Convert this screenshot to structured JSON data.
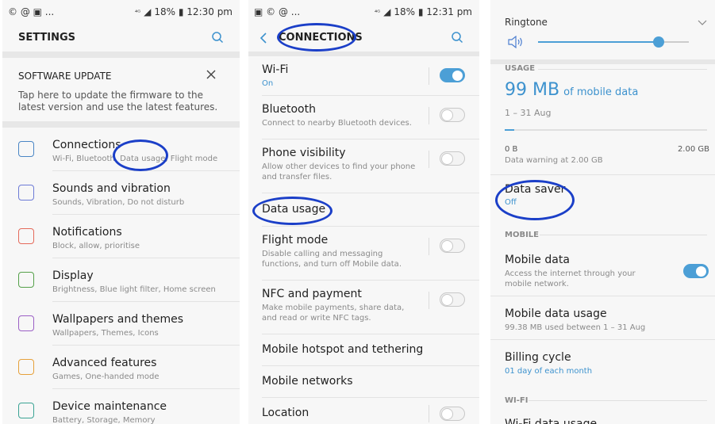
{
  "panel1": {
    "status_icons_left": "© @ ▣ ...",
    "status_right": "18% ▮ 12:30 pm",
    "title": "SETTINGS",
    "software_update": {
      "heading": "SOFTWARE UPDATE",
      "body": "Tap here to update the firmware to the latest version and use the latest features."
    },
    "items": [
      {
        "title": "Connections",
        "sub": "Wi-Fi, Bluetooth, Data usage, Flight mode",
        "icon": "connections-icon",
        "color": "#4a86c5"
      },
      {
        "title": "Sounds and vibration",
        "sub": "Sounds, Vibration, Do not disturb",
        "icon": "sound-icon",
        "color": "#6d7bd6"
      },
      {
        "title": "Notifications",
        "sub": "Block, allow, prioritise",
        "icon": "notifications-icon",
        "color": "#e56a5b"
      },
      {
        "title": "Display",
        "sub": "Brightness, Blue light filter, Home screen",
        "icon": "display-icon",
        "color": "#55a14a"
      },
      {
        "title": "Wallpapers and themes",
        "sub": "Wallpapers, Themes, Icons",
        "icon": "wallpaper-icon",
        "color": "#9b5fc5"
      },
      {
        "title": "Advanced features",
        "sub": "Games, One-handed mode",
        "icon": "advanced-features-icon",
        "color": "#e6a13b"
      },
      {
        "title": "Device maintenance",
        "sub": "Battery, Storage, Memory",
        "icon": "device-maintenance-icon",
        "color": "#3aa394"
      }
    ]
  },
  "panel2": {
    "status_icons_left": "▣ © @ ...",
    "status_right": "18% ▮ 12:31 pm",
    "title": "CONNECTIONS",
    "items": [
      {
        "title": "Wi-Fi",
        "sub": "On",
        "toggle": "on"
      },
      {
        "title": "Bluetooth",
        "sub": "Connect to nearby Bluetooth devices.",
        "toggle": "off"
      },
      {
        "title": "Phone visibility",
        "sub": "Allow other devices to find your phone and transfer files.",
        "toggle": "off"
      },
      {
        "title": "Data usage",
        "sub": "",
        "toggle": "none"
      },
      {
        "title": "Flight mode",
        "sub": "Disable calling and messaging functions, and turn off Mobile data.",
        "toggle": "off"
      },
      {
        "title": "NFC and payment",
        "sub": "Make mobile payments, share data, and read or write NFC tags.",
        "toggle": "off"
      },
      {
        "title": "Mobile hotspot and tethering",
        "sub": "",
        "toggle": "none"
      },
      {
        "title": "Mobile networks",
        "sub": "",
        "toggle": "none"
      },
      {
        "title": "Location",
        "sub": "",
        "toggle": "off"
      }
    ]
  },
  "panel3": {
    "ringtone_label": "Ringtone",
    "ringtone_level": 0.8,
    "usage_label": "USAGE",
    "usage_amount": "99 MB",
    "usage_suffix": "of mobile data",
    "usage_period": "1 – 31 Aug",
    "bar_min": "0 B",
    "bar_max": "2.00 GB",
    "data_warning": "Data warning at 2.00 GB",
    "data_saver_title": "Data saver",
    "data_saver_value": "Off",
    "mobile_section": "MOBILE",
    "mobile_data_title": "Mobile data",
    "mobile_data_sub": "Access the internet through your mobile network.",
    "mobile_data_usage_title": "Mobile data usage",
    "mobile_data_usage_sub": "99.38 MB used between 1 – 31 Aug",
    "billing_title": "Billing cycle",
    "billing_value": "01 day of each month",
    "wifi_section": "WI-FI",
    "wifi_usage_title": "Wi-Fi data usage"
  }
}
